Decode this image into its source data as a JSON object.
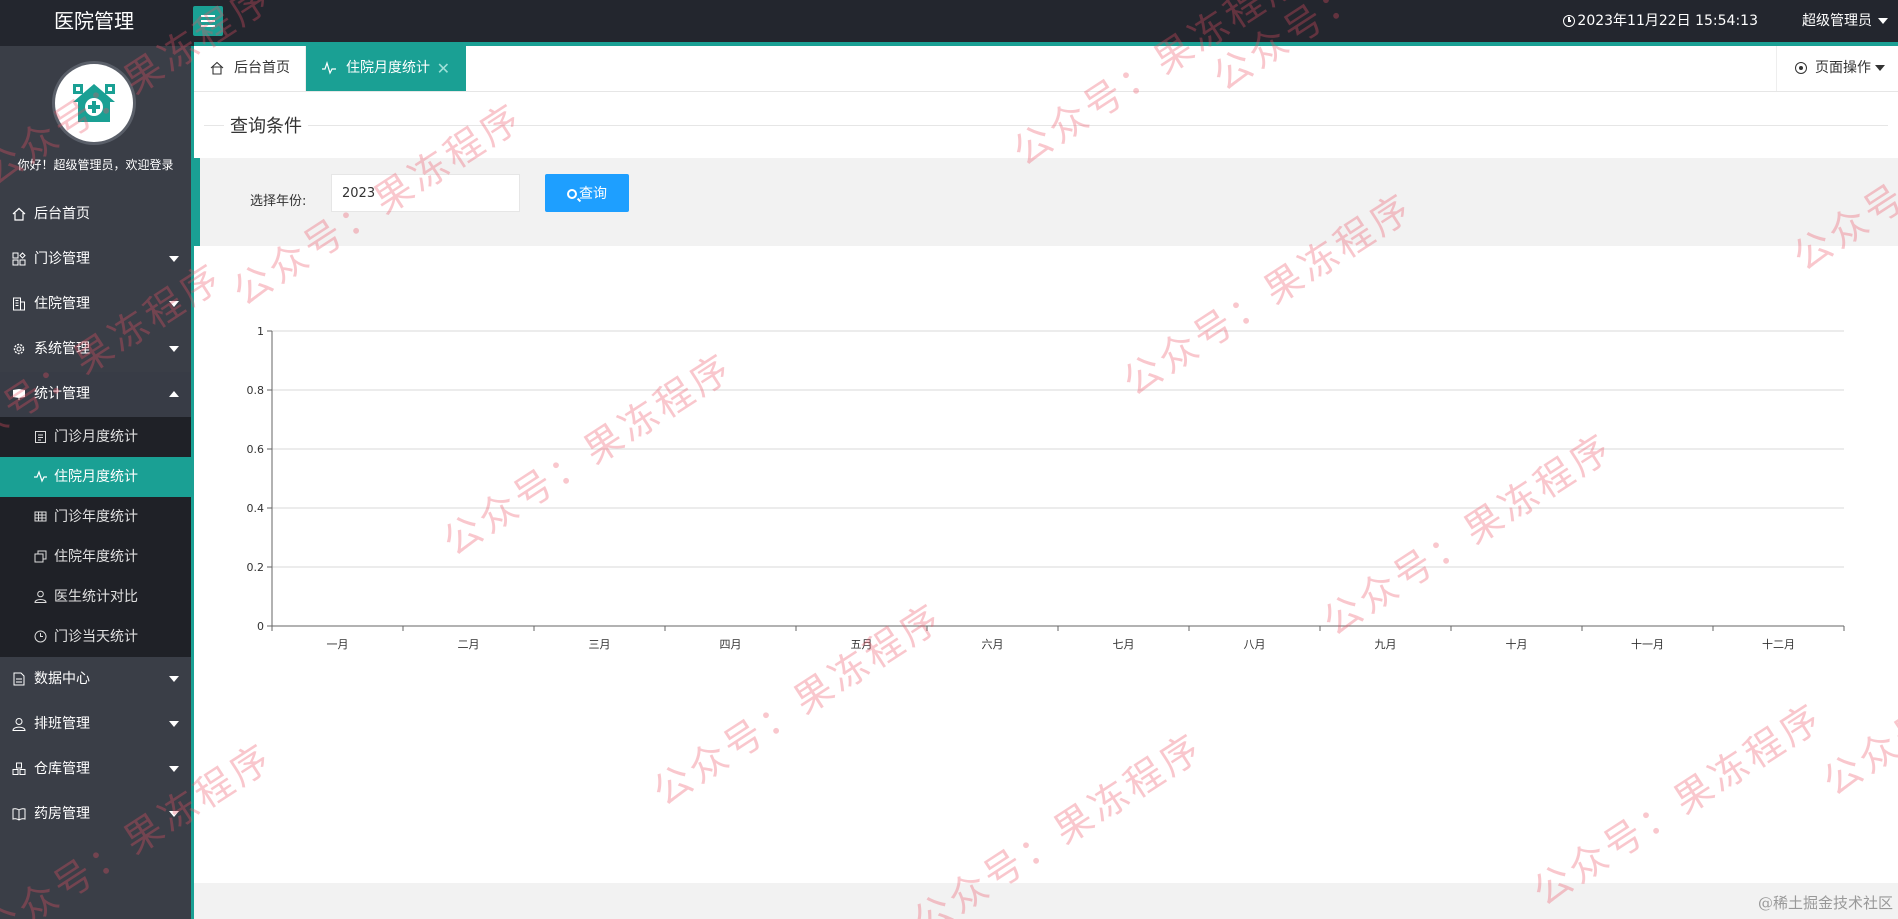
{
  "app": {
    "title": "医院管理"
  },
  "header": {
    "datetime": "2023年11月22日 15:54:13",
    "user_label": "超级管理员"
  },
  "sidebar": {
    "welcome": "你好！超级管理员，欢迎登录",
    "items": [
      {
        "label": "后台首页",
        "icon": "home-icon"
      },
      {
        "label": "门诊管理",
        "icon": "grid-icon"
      },
      {
        "label": "住院管理",
        "icon": "building-icon"
      },
      {
        "label": "系统管理",
        "icon": "gear-icon"
      },
      {
        "label": "统计管理",
        "icon": "book-icon",
        "children": [
          {
            "label": "门诊月度统计",
            "icon": "clipboard-icon"
          },
          {
            "label": "住院月度统计",
            "icon": "pulse-icon"
          },
          {
            "label": "门诊年度统计",
            "icon": "table-icon"
          },
          {
            "label": "住院年度统计",
            "icon": "copy-icon"
          },
          {
            "label": "医生统计对比",
            "icon": "user-icon"
          },
          {
            "label": "门诊当天统计",
            "icon": "clock-icon"
          }
        ]
      },
      {
        "label": "数据中心",
        "icon": "file-icon"
      },
      {
        "label": "排班管理",
        "icon": "user-icon"
      },
      {
        "label": "仓库管理",
        "icon": "cubes-icon"
      },
      {
        "label": "药房管理",
        "icon": "open-book-icon"
      }
    ]
  },
  "tabs": [
    {
      "label": "后台首页",
      "icon": "home-icon"
    },
    {
      "label": "住院月度统计",
      "icon": "pulse-icon",
      "close": "✕"
    }
  ],
  "page_ops": {
    "label": "页面操作"
  },
  "query": {
    "title": "查询条件",
    "year_label": "选择年份:",
    "year_value": "2023",
    "button_label": "查询"
  },
  "chart_data": {
    "type": "bar",
    "categories": [
      "一月",
      "二月",
      "三月",
      "四月",
      "五月",
      "六月",
      "七月",
      "八月",
      "九月",
      "十月",
      "十一月",
      "十二月"
    ],
    "values": [
      0,
      0,
      0,
      0,
      0,
      0,
      0,
      0,
      0,
      0,
      0,
      0
    ],
    "yticks": [
      "0",
      "0.2",
      "0.4",
      "0.6",
      "0.8",
      "1"
    ],
    "ylim": [
      0,
      1
    ],
    "grid": true
  },
  "watermark": {
    "text": "公众号：果冻程序"
  },
  "footer": {
    "credit": "@稀土掘金技术社区"
  },
  "colors": {
    "accent": "#1aa094",
    "button": "#1e9fff",
    "topbar": "#23262e",
    "sidebar": "#3a3e47"
  }
}
